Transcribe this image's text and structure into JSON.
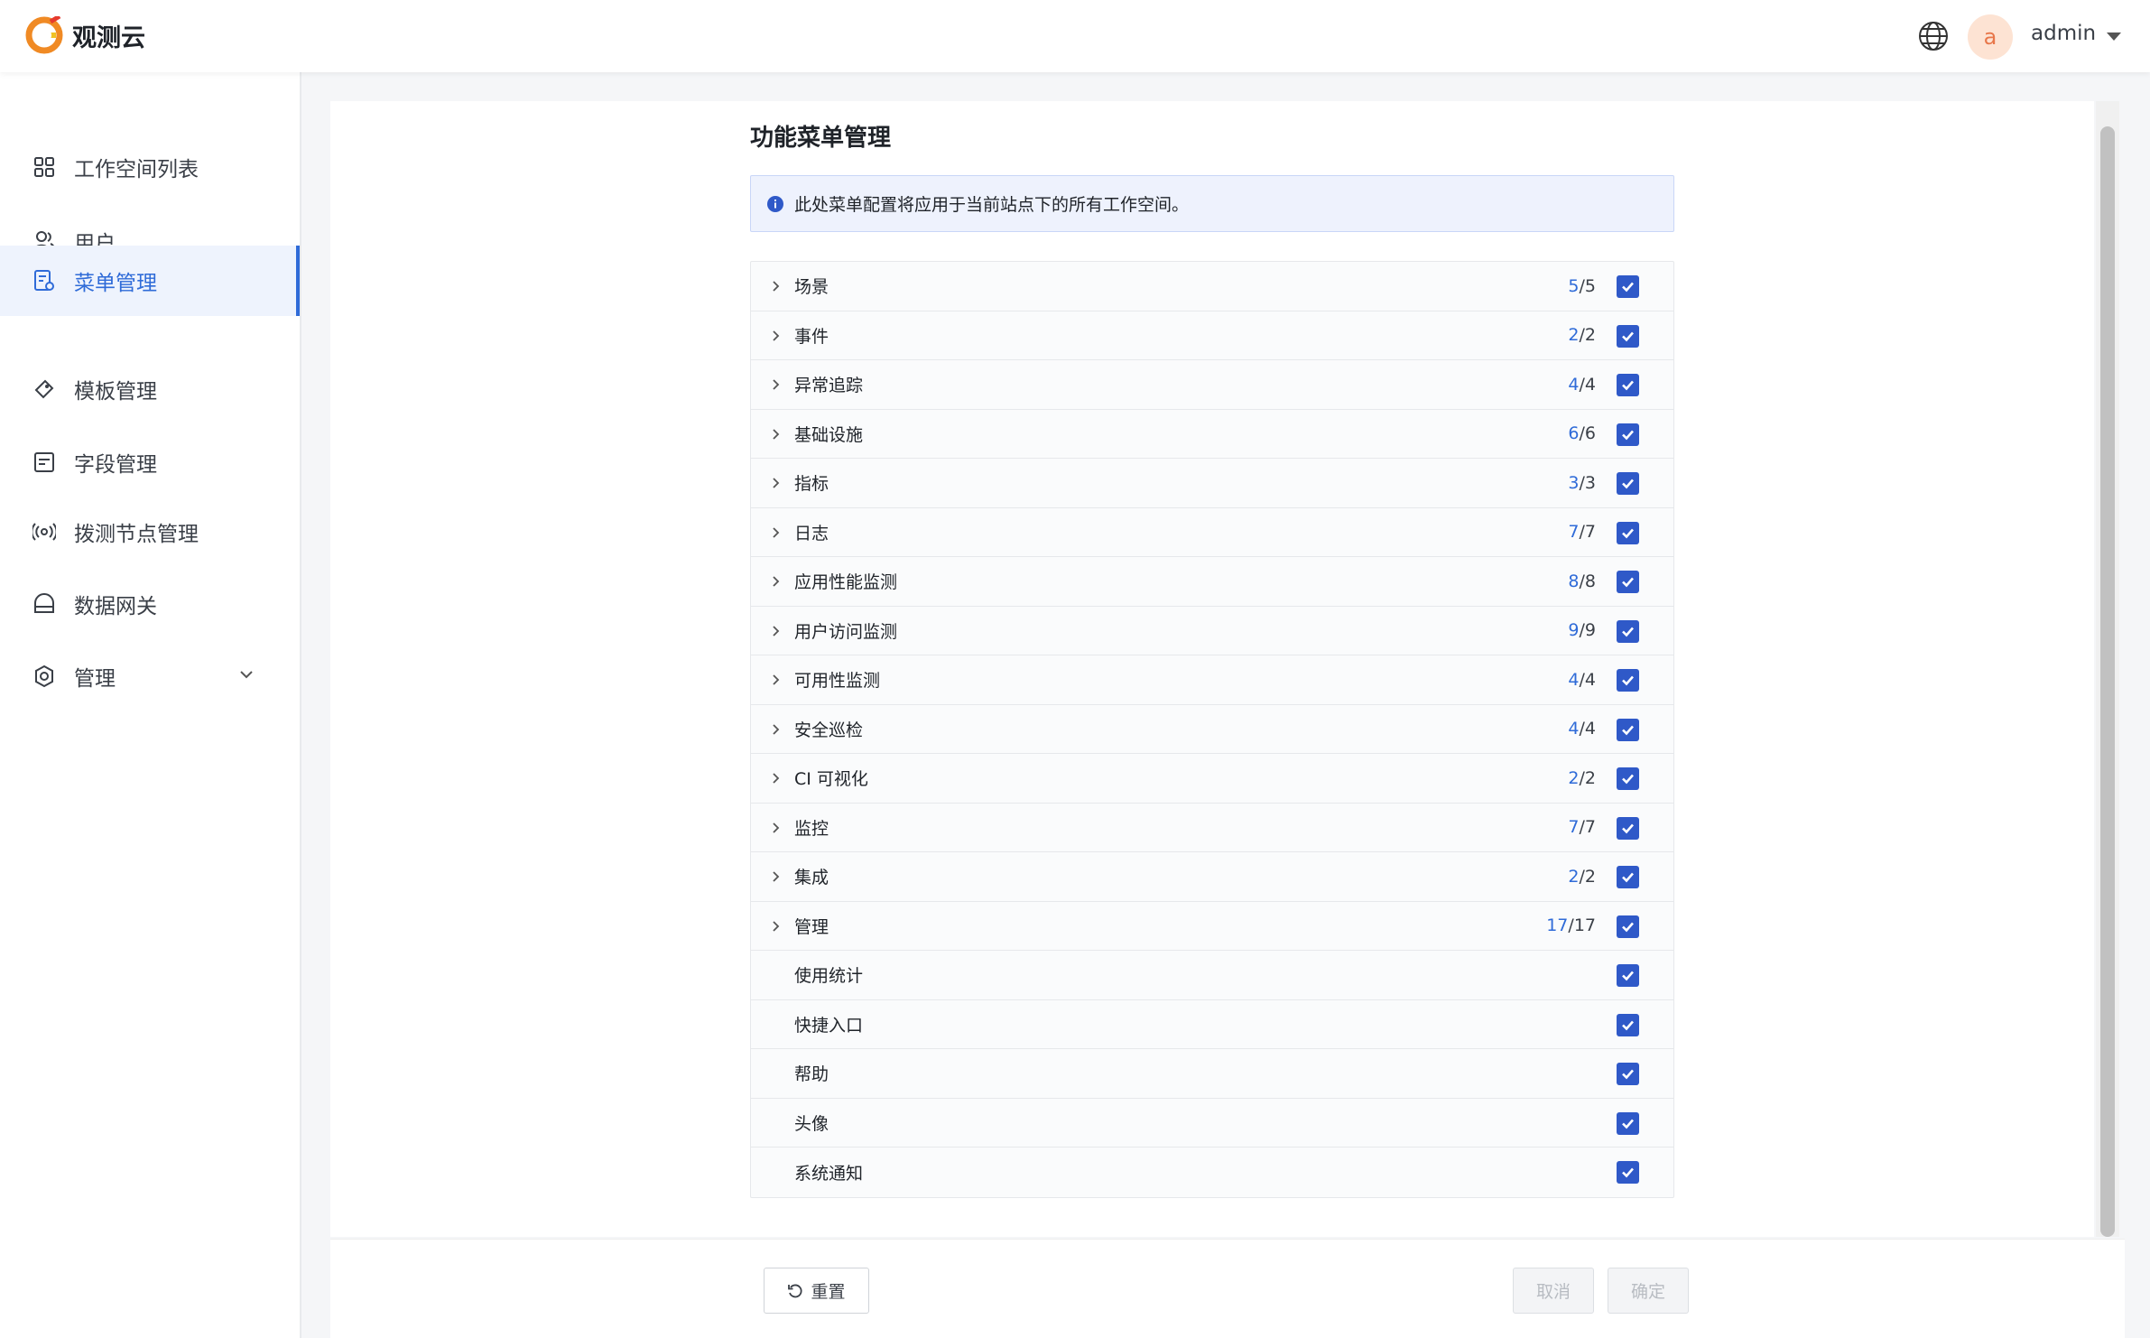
{
  "app": {
    "name": "观测云",
    "user": {
      "initial": "a",
      "name": "admin"
    }
  },
  "sidebar": {
    "items": [
      {
        "label": "工作空间列表",
        "icon": "grid-icon"
      },
      {
        "label": "用户",
        "icon": "users-icon"
      },
      {
        "label": "菜单管理",
        "icon": "menu-settings-icon",
        "active": true
      },
      {
        "label": "模板管理",
        "icon": "template-icon"
      },
      {
        "label": "字段管理",
        "icon": "field-icon"
      },
      {
        "label": "拨测节点管理",
        "icon": "broadcast-icon"
      },
      {
        "label": "数据网关",
        "icon": "gateway-icon"
      },
      {
        "label": "管理",
        "icon": "manage-gear-icon",
        "expandable": true
      }
    ]
  },
  "page": {
    "title": "功能菜单管理",
    "info": "此处菜单配置将应用于当前站点下的所有工作空间。"
  },
  "menu_rows": [
    {
      "label": "场景",
      "enabled": "5",
      "total": "5",
      "expandable": true,
      "checked": true
    },
    {
      "label": "事件",
      "enabled": "2",
      "total": "2",
      "expandable": true,
      "checked": true
    },
    {
      "label": "异常追踪",
      "enabled": "4",
      "total": "4",
      "expandable": true,
      "checked": true
    },
    {
      "label": "基础设施",
      "enabled": "6",
      "total": "6",
      "expandable": true,
      "checked": true
    },
    {
      "label": "指标",
      "enabled": "3",
      "total": "3",
      "expandable": true,
      "checked": true
    },
    {
      "label": "日志",
      "enabled": "7",
      "total": "7",
      "expandable": true,
      "checked": true
    },
    {
      "label": "应用性能监测",
      "enabled": "8",
      "total": "8",
      "expandable": true,
      "checked": true
    },
    {
      "label": "用户访问监测",
      "enabled": "9",
      "total": "9",
      "expandable": true,
      "checked": true
    },
    {
      "label": "可用性监测",
      "enabled": "4",
      "total": "4",
      "expandable": true,
      "checked": true
    },
    {
      "label": "安全巡检",
      "enabled": "4",
      "total": "4",
      "expandable": true,
      "checked": true
    },
    {
      "label": "CI 可视化",
      "enabled": "2",
      "total": "2",
      "expandable": true,
      "checked": true
    },
    {
      "label": "监控",
      "enabled": "7",
      "total": "7",
      "expandable": true,
      "checked": true
    },
    {
      "label": "集成",
      "enabled": "2",
      "total": "2",
      "expandable": true,
      "checked": true
    },
    {
      "label": "管理",
      "enabled": "17",
      "total": "17",
      "expandable": true,
      "checked": true
    },
    {
      "label": "使用统计",
      "expandable": false,
      "checked": true
    },
    {
      "label": "快捷入口",
      "expandable": false,
      "checked": true
    },
    {
      "label": "帮助",
      "expandable": false,
      "checked": true
    },
    {
      "label": "头像",
      "expandable": false,
      "checked": true
    },
    {
      "label": "系统通知",
      "expandable": false,
      "checked": true
    }
  ],
  "footer": {
    "reset_label": "重置",
    "cancel_label": "取消",
    "ok_label": "确定"
  },
  "colors": {
    "accent": "#2f6bd8",
    "checkbox": "#2f59c8",
    "info_bg": "#eef2fd"
  }
}
